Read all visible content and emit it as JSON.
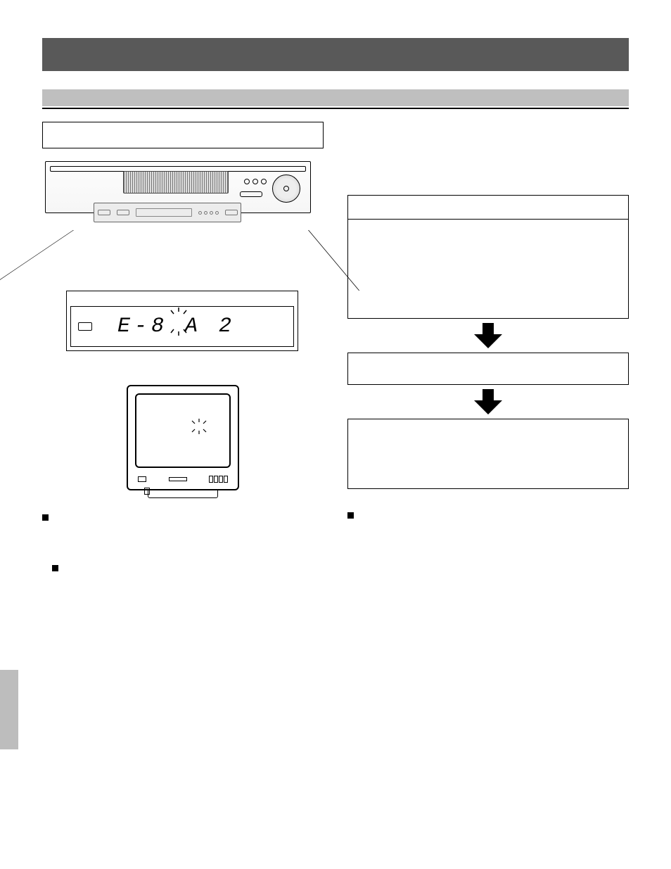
{
  "lcd_display": "E-8  A  2",
  "icons": {
    "dolby_icon_name": "dolby-icon",
    "down_arrow_name": "down-arrow-icon",
    "burst_name": "starburst-icon"
  }
}
